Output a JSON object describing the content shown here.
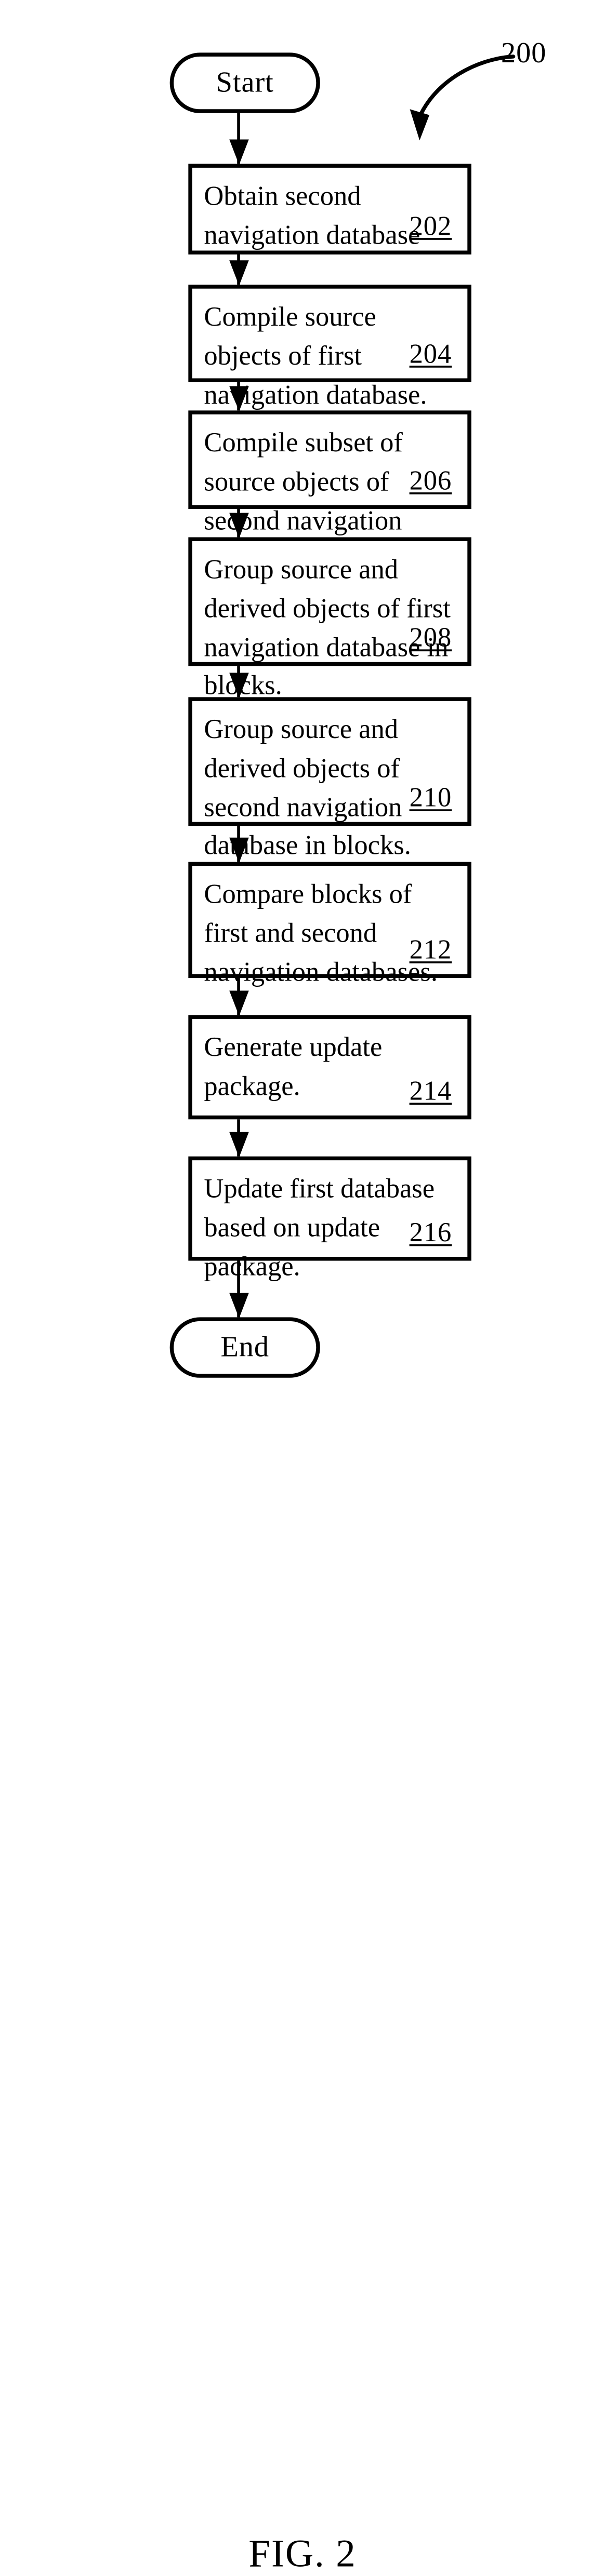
{
  "figure": {
    "caption": "FIG. 2",
    "reference_numeral": "200"
  },
  "terminals": {
    "start": {
      "label": "Start"
    },
    "end": {
      "label": "End"
    }
  },
  "steps": [
    {
      "id": "202",
      "text": "Obtain second navigation database",
      "num": "202"
    },
    {
      "id": "204",
      "text": "Compile source objects of first navigation database.",
      "num": "204"
    },
    {
      "id": "206",
      "text": "Compile subset of source objects of second navigation database.",
      "num": "206"
    },
    {
      "id": "208",
      "text": "Group source and derived objects of first navigation database in blocks.",
      "num": "208"
    },
    {
      "id": "210",
      "text": "Group source and derived objects of second navigation database in blocks.",
      "num": "210"
    },
    {
      "id": "212",
      "text": "Compare blocks of first and second navigation databases.",
      "num": "212"
    },
    {
      "id": "214",
      "text": "Generate update package.",
      "num": "214"
    },
    {
      "id": "216",
      "text": "Update first database based on update package.",
      "num": "216"
    }
  ],
  "colors": {
    "ink": "#000000",
    "paper": "#ffffff"
  }
}
